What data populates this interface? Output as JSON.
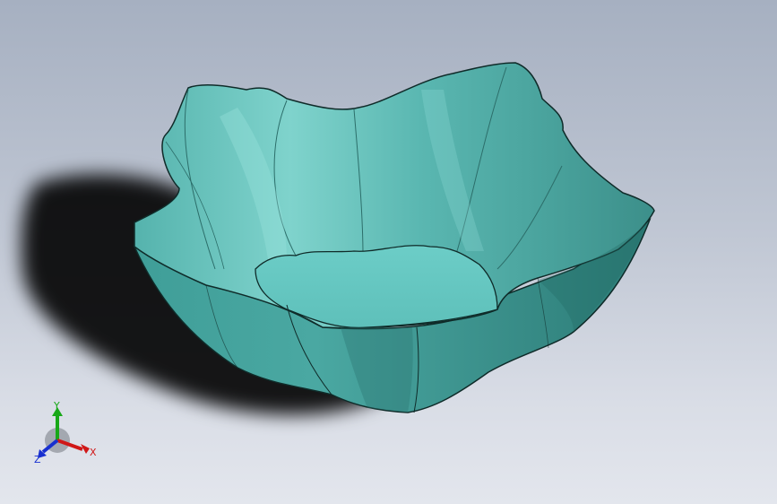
{
  "viewport": {
    "background_top": "#a6b0c1",
    "background_bottom": "#e3e6ed"
  },
  "model": {
    "name": "fluted-bowl",
    "color_main": "#5fbcb6",
    "color_dark": "#2f7d78",
    "color_light": "#7fd5cf",
    "color_floor": "#67c9c4",
    "edge_color": "#10302e"
  },
  "triad": {
    "x_label": "X",
    "y_label": "Y",
    "z_label": "Z",
    "x_color": "#d01818",
    "y_color": "#18a818",
    "z_color": "#1830d0"
  }
}
